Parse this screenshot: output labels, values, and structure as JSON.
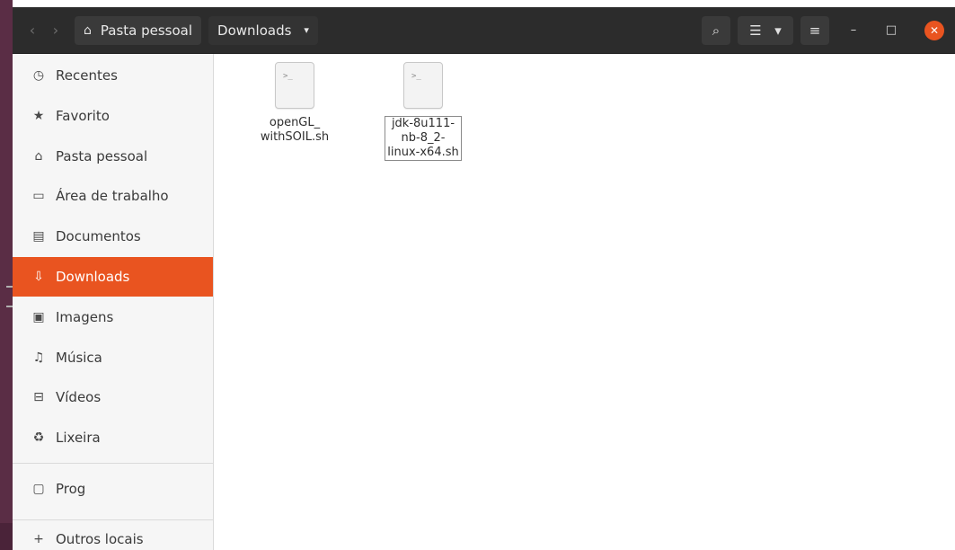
{
  "header": {
    "back_glyph": "‹",
    "forward_glyph": "›",
    "path": [
      {
        "label": "Pasta pessoal",
        "icon": "home-icon"
      },
      {
        "label": "Downloads",
        "icon": "chevron-down-icon"
      }
    ],
    "tools": {
      "search_glyph": "⌕",
      "view_glyph": "☰",
      "view_caret": "▾",
      "menu_glyph": "≡",
      "minimize_glyph": "–",
      "maximize_glyph": "□",
      "close_glyph": "✕"
    }
  },
  "sidebar": {
    "items": [
      {
        "label": "Recentes",
        "icon": "clock-icon",
        "glyph": "◷"
      },
      {
        "label": "Favorito",
        "icon": "star-icon",
        "glyph": "★"
      },
      {
        "label": "Pasta pessoal",
        "icon": "home-icon",
        "glyph": "⌂"
      },
      {
        "label": "Área de trabalho",
        "icon": "desktop-icon",
        "glyph": "▭"
      },
      {
        "label": "Documentos",
        "icon": "document-icon",
        "glyph": "▤"
      },
      {
        "label": "Downloads",
        "icon": "download-icon",
        "glyph": "⇩",
        "active": true
      },
      {
        "label": "Imagens",
        "icon": "image-icon",
        "glyph": "▣"
      },
      {
        "label": "Música",
        "icon": "music-icon",
        "glyph": "♫"
      },
      {
        "label": "Vídeos",
        "icon": "video-icon",
        "glyph": "⊟"
      },
      {
        "label": "Lixeira",
        "icon": "trash-icon",
        "glyph": "♻"
      },
      {
        "label": "Prog",
        "icon": "folder-icon",
        "glyph": "▢"
      },
      {
        "label": "Outros locais",
        "icon": "plus-icon",
        "glyph": "+"
      }
    ]
  },
  "files": [
    {
      "name": "openGL_\nwithSOIL.sh",
      "prompt": ">_"
    },
    {
      "name": "jdk-8u111-\nnb-8_2-\nlinux-x64.sh",
      "prompt": ">_",
      "selected": true
    }
  ],
  "colors": {
    "accent": "#e95420",
    "headerbar": "#2c2c2c",
    "sidebar_bg": "#f6f6f6"
  }
}
